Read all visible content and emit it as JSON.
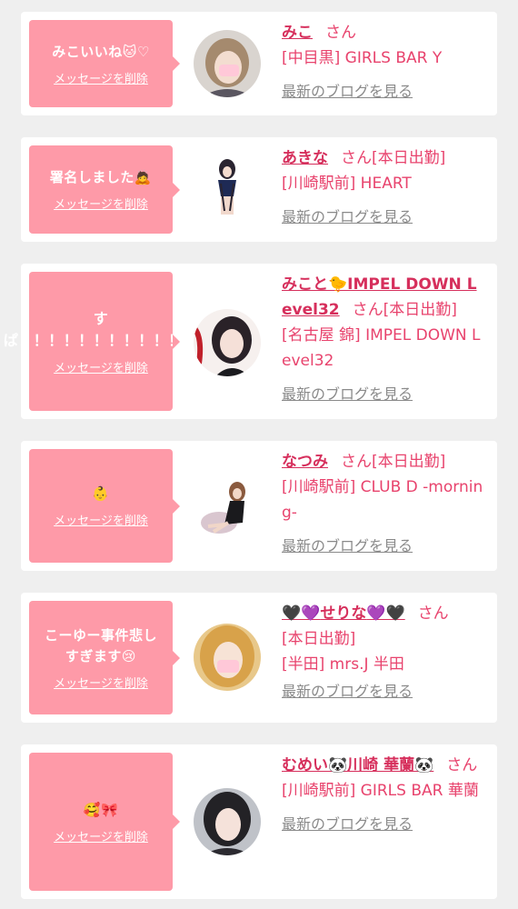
{
  "common": {
    "delete_label": "メッセージを削除",
    "san_label": "さん",
    "blog_link": "最新のブログを見る",
    "accent_color": "#fe9aa8",
    "name_color": "#d62f5c"
  },
  "items": [
    {
      "message": "みこいいね🐱♡",
      "name": "みこ",
      "status": "",
      "shop": "[中目黒] GIRLS BAR Y"
    },
    {
      "message": "署名しました🙇",
      "name": "あきな",
      "status": "[本日出勤]",
      "shop": "[川崎駅前] HEART"
    },
    {
      "message": "すぱ！！！！！！！！！！！！",
      "name": "みこと🐤IMPEL DOWN Level32",
      "status": "[本日出勤]",
      "shop": "[名古屋 錦] IMPEL DOWN Level32"
    },
    {
      "message": "👶",
      "name": "なつみ",
      "status": "[本日出勤]",
      "shop": "[川崎駅前] CLUB D -morning-"
    },
    {
      "message": "こーゆー事件悲しすぎます😢",
      "name_prefix": "🖤💜",
      "name_text": "せりな",
      "name_suffix": "💜🖤",
      "status": "[本日出勤]",
      "shop": "[半田] mrs.J 半田"
    },
    {
      "message": "🥰🎀",
      "name": "むめい🐼川崎 華蘭🐼",
      "status": "",
      "shop": "[川崎駅前] GIRLS BAR 華蘭"
    }
  ]
}
